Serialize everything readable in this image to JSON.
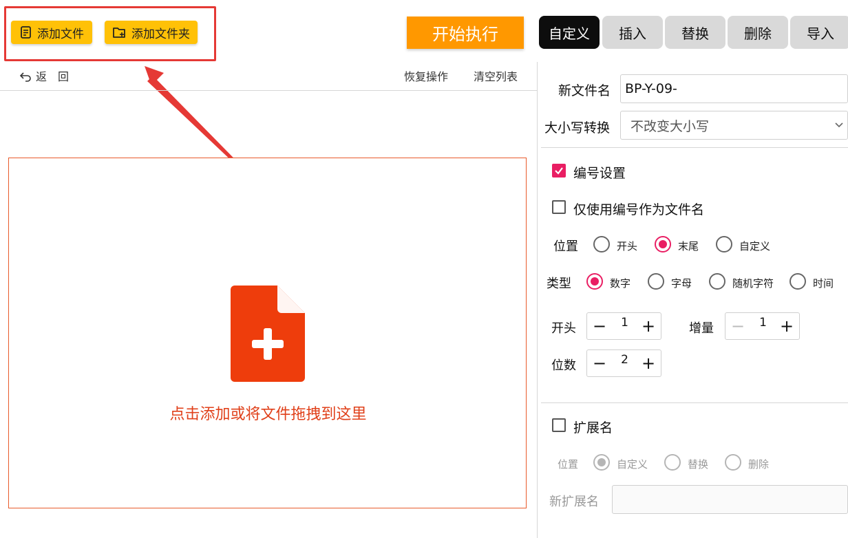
{
  "toolbar": {
    "add_file_label": "添加文件",
    "add_folder_label": "添加文件夹",
    "run_label": "开始执行"
  },
  "tabs": [
    {
      "label": "自定义",
      "active": true
    },
    {
      "label": "插入",
      "active": false
    },
    {
      "label": "替换",
      "active": false
    },
    {
      "label": "删除",
      "active": false
    },
    {
      "label": "导入",
      "active": false
    }
  ],
  "subbar": {
    "back_label": "返　回",
    "restore_label": "恢复操作",
    "clear_label": "清空列表"
  },
  "dropzone": {
    "text": "点击添加或将文件拖拽到这里"
  },
  "panel": {
    "new_name_label": "新文件名",
    "new_name_value": "BP-Y-09-",
    "case_label": "大小写转换",
    "case_value": "不改变大小写",
    "numbering": {
      "label": "编号设置",
      "checked": true,
      "only_number_label": "仅使用编号作为文件名",
      "only_number_checked": false,
      "position_label": "位置",
      "position_options": [
        "开头",
        "末尾",
        "自定义"
      ],
      "position_selected": "末尾",
      "type_label": "类型",
      "type_options": [
        "数字",
        "字母",
        "随机字符",
        "时间"
      ],
      "type_selected": "数字",
      "start_label": "开头",
      "start_value": "1",
      "increment_label": "增量",
      "increment_value": "1",
      "digits_label": "位数",
      "digits_value": "2"
    },
    "extension": {
      "label": "扩展名",
      "checked": false,
      "position_label": "位置",
      "options": [
        "自定义",
        "替换",
        "删除"
      ],
      "selected": "自定义",
      "new_ext_label": "新扩展名",
      "new_ext_value": ""
    }
  },
  "colors": {
    "accent_yellow": "#ffc107",
    "run_orange": "#ff9800",
    "annotation_red": "#e53935",
    "drop_red": "#e0401a",
    "check_pink": "#e91e63"
  }
}
